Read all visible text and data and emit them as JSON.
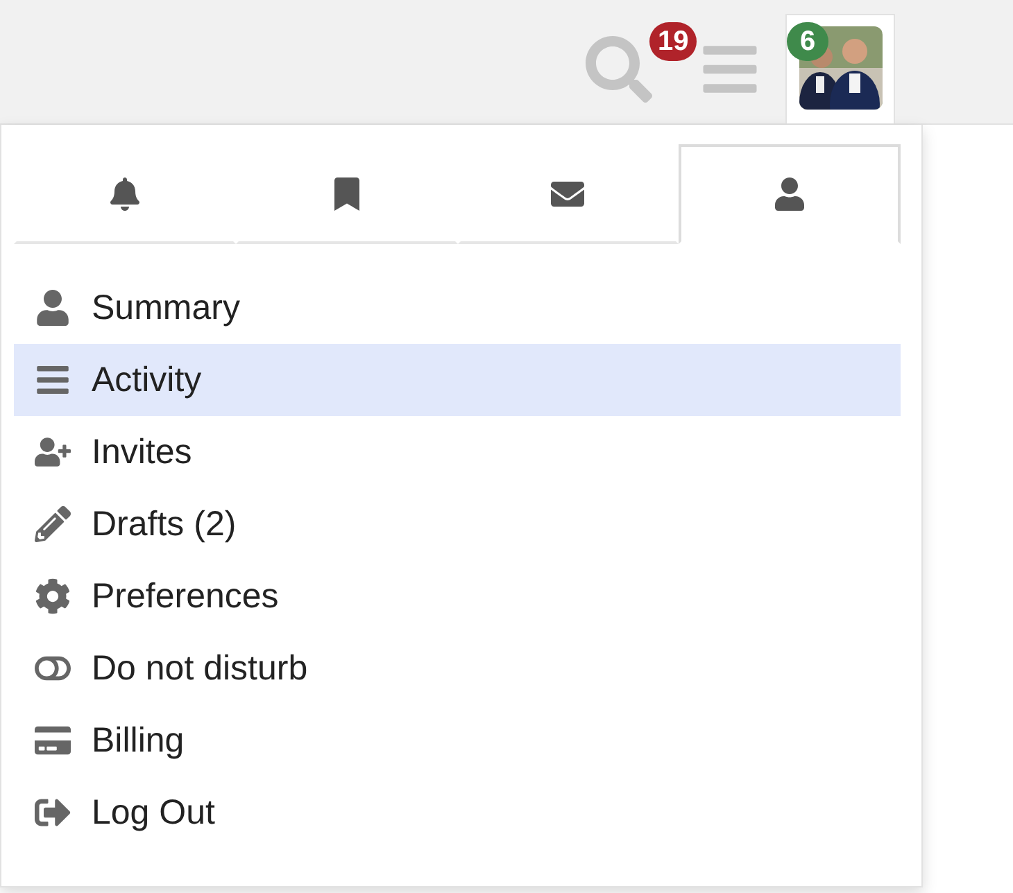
{
  "header": {
    "menu_badge": "19",
    "avatar_badge": "6"
  },
  "tabs": [
    {
      "selected": false
    },
    {
      "selected": false
    },
    {
      "selected": false
    },
    {
      "selected": true
    }
  ],
  "menu_items": [
    {
      "label": "Summary",
      "selected": false
    },
    {
      "label": "Activity",
      "selected": true
    },
    {
      "label": "Invites",
      "selected": false
    },
    {
      "label": "Drafts (2)",
      "selected": false
    },
    {
      "label": "Preferences",
      "selected": false
    },
    {
      "label": "Do not disturb",
      "selected": false
    },
    {
      "label": "Billing",
      "selected": false
    },
    {
      "label": "Log Out",
      "selected": false
    }
  ]
}
